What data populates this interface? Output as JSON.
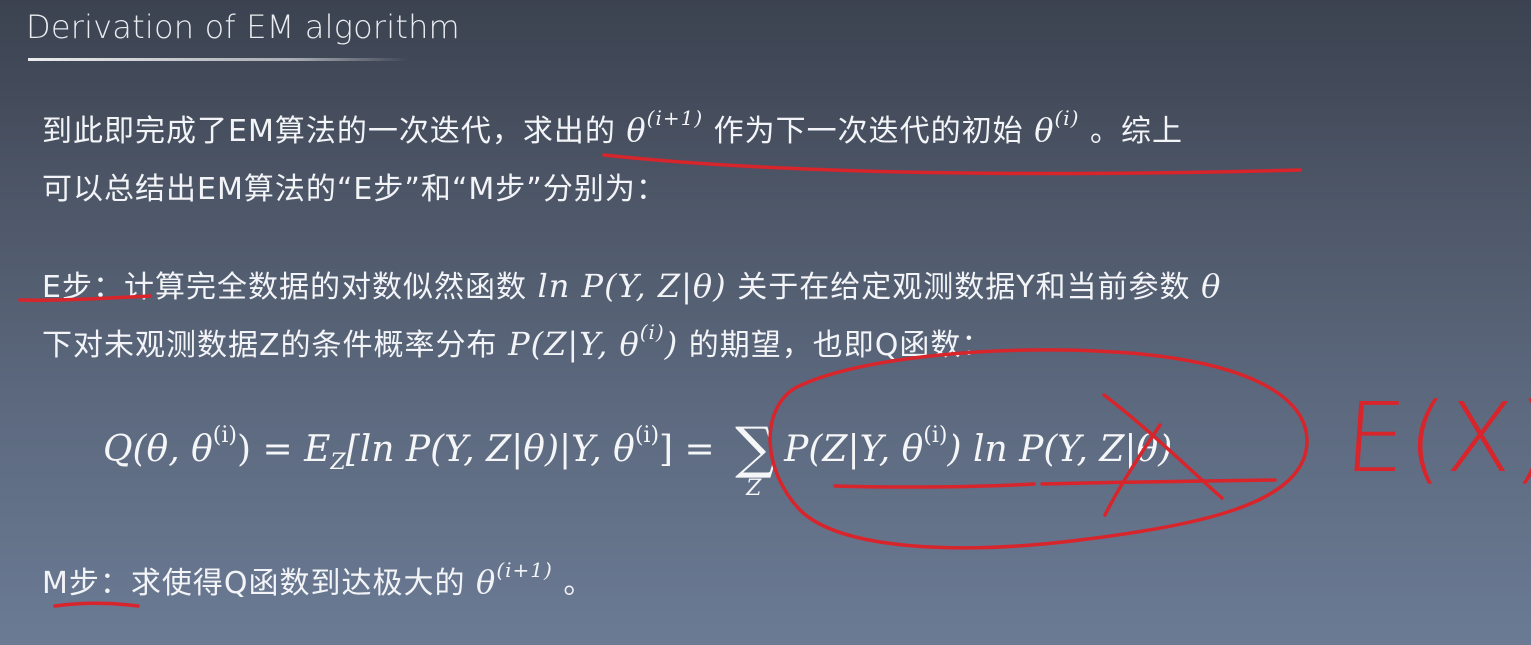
{
  "slide": {
    "title": "Derivation of EM algorithm"
  },
  "para1": {
    "line1_text_a": "到此即完成了EM算法的一次迭代，求出的 ",
    "line1_math_a": "θ",
    "line1_sup_a": "(i+1)",
    "line1_text_b": " 作为下一次迭代的初始 ",
    "line1_math_b": "θ",
    "line1_sup_b": "(i)",
    "line1_text_c": " 。综上",
    "line2": "可以总结出EM算法的“E步”和“M步”分别为："
  },
  "estep": {
    "label": "E步：",
    "line1_text_a": "计算完全数据的对数似然函数 ",
    "line1_math": "ln P(Y, Z|θ)",
    "line1_text_b": " 关于在给定观测数据Y和当前参数 ",
    "line1_theta": "θ",
    "line2_text_a": "下对未观测数据Z的条件概率分布 ",
    "line2_math": "P(Z|Y, θ",
    "line2_sup": "(i)",
    "line2_close": ")",
    "line2_text_b": " 的期望，也即Q函数："
  },
  "equation": {
    "lhs": "Q(θ, θ",
    "lhs_sup": "(i)",
    "lhs_close": ") = ",
    "e": "E",
    "e_sub": "Z",
    "mid": "[ln P(Y, Z|θ)|Y, θ",
    "mid_sup": "(i)",
    "mid_close": "] = ",
    "sum_symbol": "∑",
    "sum_index": "Z",
    "rhs_a": "P(Z|Y, θ",
    "rhs_sup": "(i)",
    "rhs_b": ") ln P(Y, Z|θ)"
  },
  "mstep": {
    "label": "M步：",
    "text_a": "求使得Q函数到达极大的 ",
    "math": "θ",
    "sup": "(i+1)",
    "text_b": " 。"
  },
  "annotations": {
    "handwritten_note": "E(X)",
    "ink_color": "#d8242b"
  }
}
